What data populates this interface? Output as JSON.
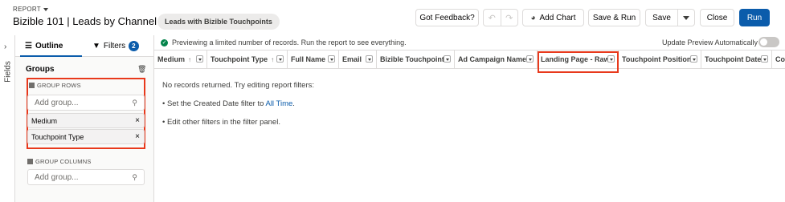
{
  "header": {
    "report_label": "REPORT",
    "title": "Bizible 101 | Leads by Channel",
    "report_type_pill": "Leads with Bizible Touchpoints",
    "feedback_label": "Got Feedback?",
    "add_chart_label": "Add Chart",
    "save_run_label": "Save & Run",
    "save_label": "Save",
    "close_label": "Close",
    "run_label": "Run"
  },
  "left_strip": {
    "fields_label": "Fields"
  },
  "panel": {
    "tab_outline": "Outline",
    "tab_filters": "Filters",
    "filters_count": "2",
    "groups_heading": "Groups",
    "group_rows_label": "GROUP ROWS",
    "add_group_placeholder": "Add group...",
    "group_rows": [
      "Medium",
      "Touchpoint Type"
    ],
    "group_columns_label": "GROUP COLUMNS",
    "add_group_columns_placeholder": "Add group..."
  },
  "main": {
    "preview_notice": "Previewing a limited number of records. Run the report to see everything.",
    "update_preview_label": "Update Preview Automatically",
    "columns": [
      "Medium",
      "Touchpoint Type",
      "Full Name",
      "Email",
      "Bizible Touchpoint",
      "Ad Campaign Name",
      "Landing Page - Raw",
      "Touchpoint Position",
      "Touchpoint Date",
      "Co"
    ],
    "no_records": "No records returned. Try editing report filters:",
    "bullet1_prefix": "• Set the Created Date filter to ",
    "bullet1_link": "All Time",
    "bullet1_suffix": ".",
    "bullet2": "• Edit other filters in the filter panel."
  },
  "colors": {
    "accent": "#0b5cab",
    "highlight": "#e8391c"
  },
  "icons": [
    "chevron-down-icon",
    "pencil-icon",
    "undo-icon",
    "redo-icon",
    "chart-icon",
    "list-icon",
    "filter-icon",
    "trash-icon",
    "search-icon",
    "close-icon",
    "check-icon",
    "sort-up-icon"
  ]
}
